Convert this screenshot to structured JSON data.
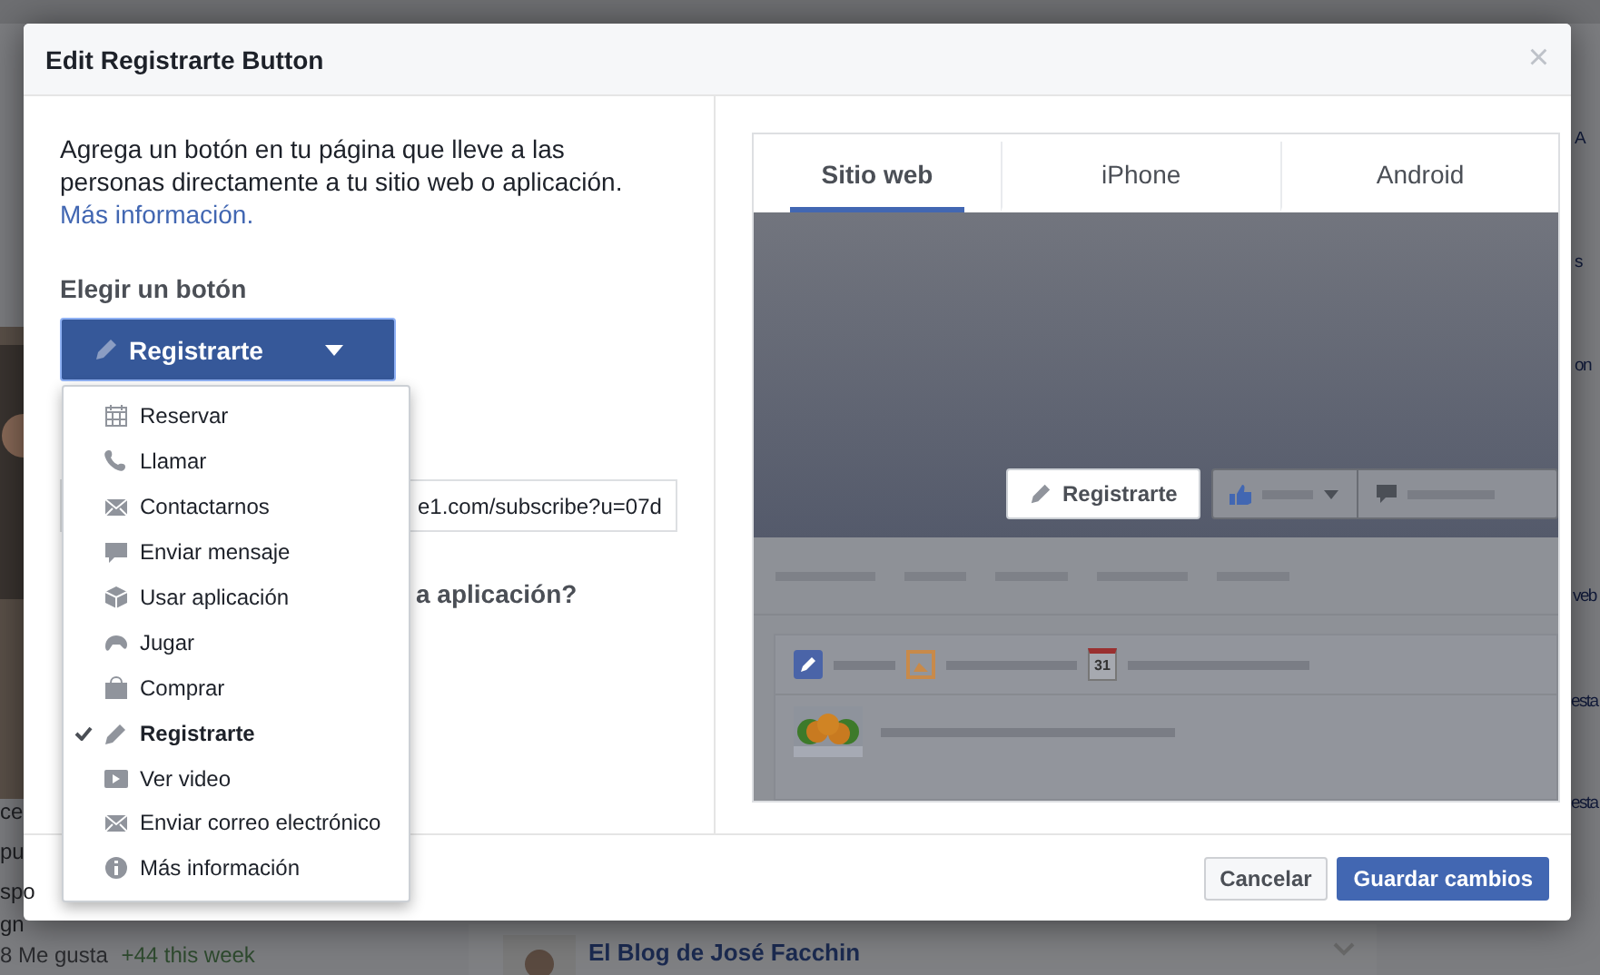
{
  "background": {
    "blog_title": "El Blog de José Facchin",
    "likes": "8 Me gusta",
    "likes_change": "+44 this week",
    "left_fragments": [
      "ce",
      "pu",
      "spo",
      "gn"
    ],
    "right_fragments": [
      "A",
      "s",
      "on",
      "veb",
      "esta",
      "esta"
    ]
  },
  "dialog": {
    "title": "Edit Registrarte Button",
    "close": "×",
    "intro": "Agrega un botón en tu página que lleve a las personas directamente a tu sitio web o aplicación.",
    "learn_more": "Más información.",
    "choose_label": "Elegir un botón",
    "choice": "Registrarte",
    "url_value": "e1.com/subscribe?u=07d",
    "question": "a aplicación?",
    "menu": [
      {
        "label": "Reservar",
        "selected": false
      },
      {
        "label": "Llamar",
        "selected": false
      },
      {
        "label": "Contactarnos",
        "selected": false
      },
      {
        "label": "Enviar mensaje",
        "selected": false
      },
      {
        "label": "Usar aplicación",
        "selected": false
      },
      {
        "label": "Jugar",
        "selected": false
      },
      {
        "label": "Comprar",
        "selected": false
      },
      {
        "label": "Registrarte",
        "selected": true
      },
      {
        "label": "Ver video",
        "selected": false
      },
      {
        "label": "Enviar correo electrónico",
        "selected": false
      },
      {
        "label": "Más información",
        "selected": false
      }
    ],
    "preview_tabs": [
      {
        "label": "Sitio web",
        "selected": true
      },
      {
        "label": "iPhone",
        "selected": false
      },
      {
        "label": "Android",
        "selected": false
      }
    ],
    "preview_button": "Registrarte",
    "preview_date": "31",
    "buttons": [
      {
        "label": "Cancelar",
        "kind": "secondary"
      },
      {
        "label": "Guardar cambios",
        "kind": "primary"
      }
    ]
  }
}
